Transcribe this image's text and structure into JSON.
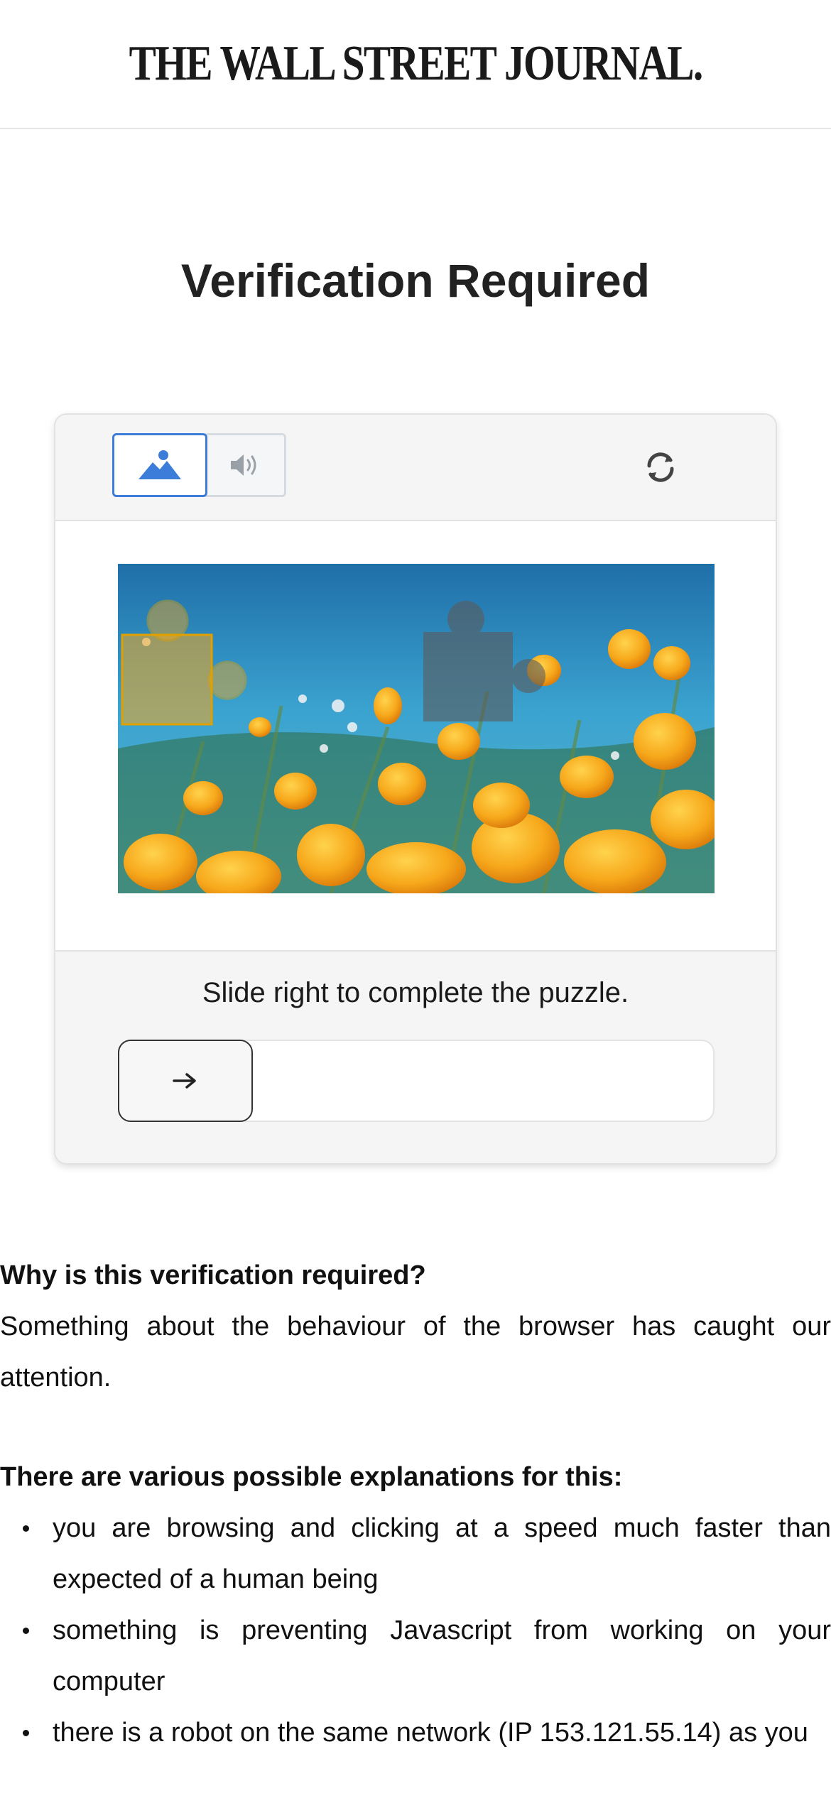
{
  "header": {
    "logo_text": "THE WALL STREET JOURNAL."
  },
  "page": {
    "title": "Verification Required"
  },
  "captcha": {
    "modes": [
      {
        "name": "image",
        "icon": "image-icon",
        "selected": true
      },
      {
        "name": "audio",
        "icon": "speaker-icon",
        "selected": false
      }
    ],
    "refresh_icon": "refresh-icon",
    "accent_color": "#3b7dd8",
    "image_description_icon": "puzzle-piece-icon",
    "instruction": "Slide right to complete the puzzle.",
    "slider": {
      "handle_icon": "arrow-right-icon",
      "progress": 0
    }
  },
  "info": {
    "why_heading": "Why is this verification required?",
    "why_text": "Something about the behaviour of the browser has caught our attention.",
    "explanations_heading": "There are various possible explanations for this:",
    "reasons": [
      "you are browsing and clicking at a speed much faster than expected of a human being",
      "something is preventing Javascript from working on your computer",
      "there is a robot on the same network (IP 153.121.55.14) as you"
    ]
  }
}
